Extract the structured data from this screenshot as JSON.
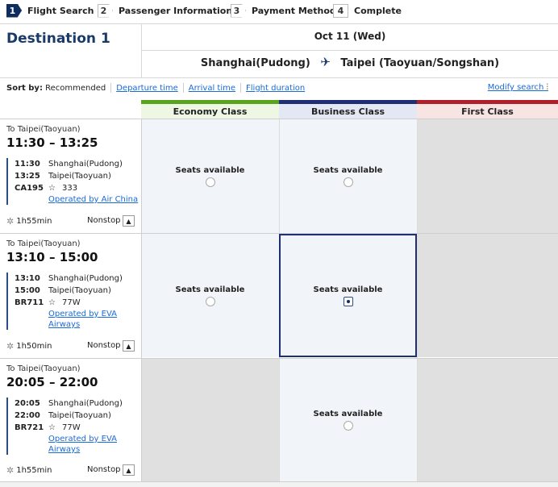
{
  "steps": [
    {
      "num": "1",
      "label": "Flight Search",
      "active": true
    },
    {
      "num": "2",
      "label": "Passenger Information",
      "active": false
    },
    {
      "num": "3",
      "label": "Payment Method",
      "active": false
    },
    {
      "num": "4",
      "label": "Complete",
      "active": false
    }
  ],
  "header": {
    "destination_title": "Destination 1",
    "date": "Oct 11 (Wed)",
    "origin": "Shanghai(Pudong)",
    "destination": "Taipei (Taoyuan/Songshan)"
  },
  "sort": {
    "label": "Sort by:",
    "current": "Recommended",
    "options": [
      "Departure time",
      "Arrival time",
      "Flight duration"
    ],
    "modify_label": "Modify search"
  },
  "classes": [
    "Economy Class",
    "Business Class",
    "First Class"
  ],
  "flights": [
    {
      "to": "To Taipei(Taoyuan)",
      "times": "11:30  –  13:25",
      "dep_time": "11:30",
      "dep_airport": "Shanghai(Pudong)",
      "arr_time": "13:25",
      "arr_airport": "Taipei(Taoyuan)",
      "flight_no": "CA195",
      "aircraft": "333",
      "operated_by": "Operated by Air China",
      "duration": "1h55min",
      "stops": "Nonstop",
      "economy": "Seats available",
      "business": "Seats available",
      "first": ""
    },
    {
      "to": "To Taipei(Taoyuan)",
      "times": "13:10  –  15:00",
      "dep_time": "13:10",
      "dep_airport": "Shanghai(Pudong)",
      "arr_time": "15:00",
      "arr_airport": "Taipei(Taoyuan)",
      "flight_no": "BR711",
      "aircraft": "77W",
      "operated_by": "Operated by EVA Airways",
      "duration": "1h50min",
      "stops": "Nonstop",
      "economy": "Seats available",
      "business": "Seats available",
      "first": ""
    },
    {
      "to": "To Taipei(Taoyuan)",
      "times": "20:05  –  22:00",
      "dep_time": "20:05",
      "dep_airport": "Shanghai(Pudong)",
      "arr_time": "22:00",
      "arr_airport": "Taipei(Taoyuan)",
      "flight_no": "BR721",
      "aircraft": "77W",
      "operated_by": "Operated by EVA Airways",
      "duration": "1h55min",
      "stops": "Nonstop",
      "economy": "",
      "business": "Seats available",
      "first": ""
    }
  ],
  "selected": {
    "flight": 2,
    "class": "Business Class"
  },
  "colors": {
    "brand": "#0e2c5e",
    "economy": "#5aa31e",
    "business": "#1f2f75",
    "first": "#b0202a",
    "link": "#1a6ad8"
  }
}
